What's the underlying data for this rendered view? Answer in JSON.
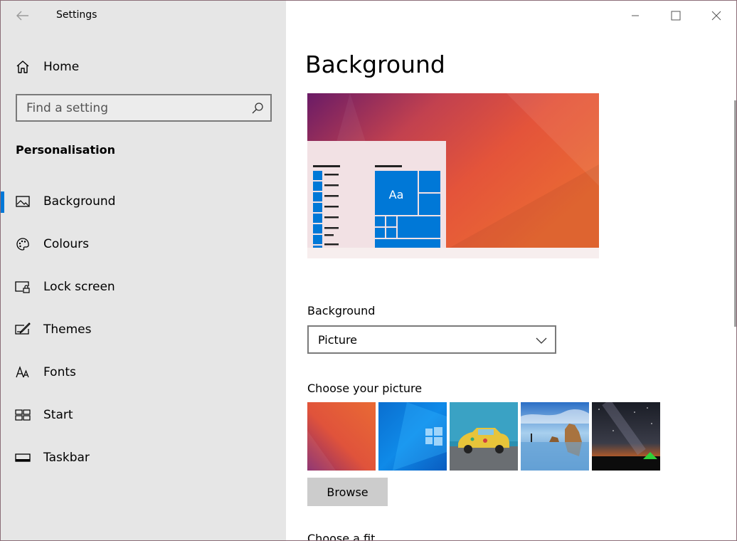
{
  "app": {
    "title": "Settings"
  },
  "sidebar": {
    "home_label": "Home",
    "search_placeholder": "Find a setting",
    "section_title": "Personalisation",
    "items": [
      {
        "label": "Background",
        "icon": "picture-icon",
        "selected": true
      },
      {
        "label": "Colours",
        "icon": "palette-icon",
        "selected": false
      },
      {
        "label": "Lock screen",
        "icon": "lock-screen-icon",
        "selected": false
      },
      {
        "label": "Themes",
        "icon": "themes-icon",
        "selected": false
      },
      {
        "label": "Fonts",
        "icon": "fonts-icon",
        "selected": false
      },
      {
        "label": "Start",
        "icon": "start-icon",
        "selected": false
      },
      {
        "label": "Taskbar",
        "icon": "taskbar-icon",
        "selected": false
      }
    ]
  },
  "main": {
    "title": "Background",
    "preview": {
      "sample_text": "Aa"
    },
    "background_label": "Background",
    "background_value": "Picture",
    "choose_picture_label": "Choose your picture",
    "pictures": [
      {
        "name": "orange-purple-abstract"
      },
      {
        "name": "windows-blue-light"
      },
      {
        "name": "yellow-car"
      },
      {
        "name": "beach-rock-arch"
      },
      {
        "name": "night-sky-tent"
      }
    ],
    "browse_label": "Browse",
    "choose_fit_label": "Choose a fit"
  },
  "colors": {
    "accent": "#0078d7",
    "sidebar_bg": "#e6e6e6",
    "button_bg": "#cccccc"
  }
}
